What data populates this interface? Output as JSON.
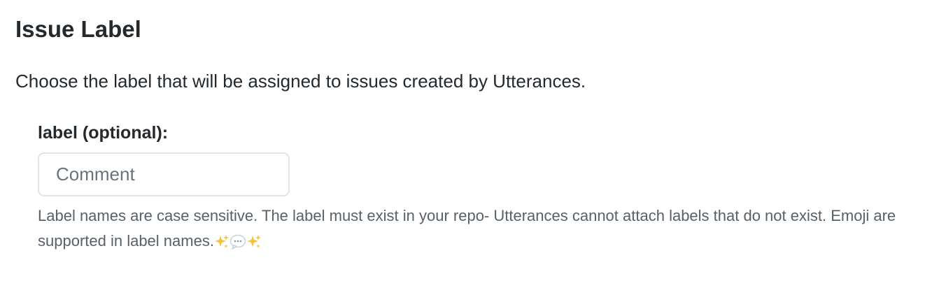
{
  "section": {
    "title": "Issue Label",
    "description": "Choose the label that will be assigned to issues created by Utterances."
  },
  "label_field": {
    "label": "label (optional):",
    "placeholder": "Comment",
    "value": "",
    "note_text": "Label names are case sensitive. The label must exist in your repo- Utterances cannot attach labels that do not exist. Emoji are supported in label names.",
    "note_emojis": [
      "sparkles-icon",
      "speech-balloon-icon",
      "sparkles-icon"
    ]
  },
  "colors": {
    "text": "#24292e",
    "muted": "#586069",
    "placeholder": "#6a737d",
    "input_border": "#e1e4e8",
    "sparkle": "#f5c33b",
    "speech_bubble": "#c9d1d9"
  }
}
